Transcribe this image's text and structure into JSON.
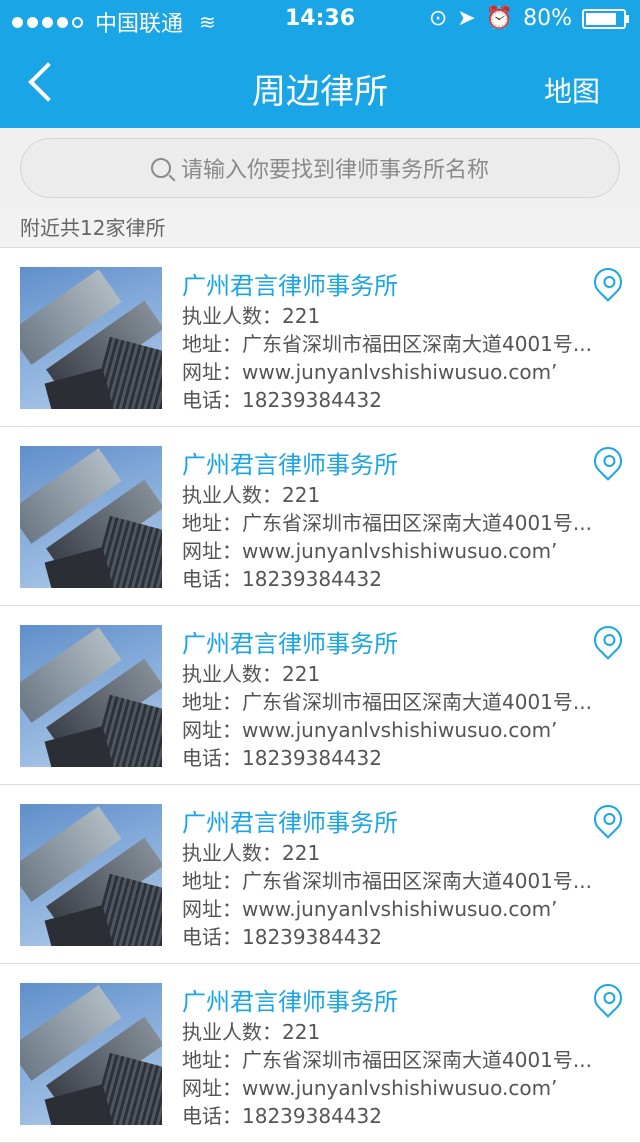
{
  "status": {
    "carrier": "中国联通",
    "time": "14:36",
    "battery": "80%"
  },
  "nav": {
    "title": "周边律所",
    "map_button": "地图"
  },
  "search": {
    "placeholder": "请输入你要找到律师事务所名称"
  },
  "summary": "附近共12家律所",
  "firms": [
    {
      "name": "广州君言律师事务所",
      "staff": "执业人数：221",
      "address": "地址：广东省深圳市福田区深南大道4001号...",
      "website": "网址：www.junyanlvshishiwusuo.com’",
      "phone": "电话：18239384432"
    },
    {
      "name": "广州君言律师事务所",
      "staff": "执业人数：221",
      "address": "地址：广东省深圳市福田区深南大道4001号...",
      "website": "网址：www.junyanlvshishiwusuo.com’",
      "phone": "电话：18239384432"
    },
    {
      "name": "广州君言律师事务所",
      "staff": "执业人数：221",
      "address": "地址：广东省深圳市福田区深南大道4001号...",
      "website": "网址：www.junyanlvshishiwusuo.com’",
      "phone": "电话：18239384432"
    },
    {
      "name": "广州君言律师事务所",
      "staff": "执业人数：221",
      "address": "地址：广东省深圳市福田区深南大道4001号...",
      "website": "网址：www.junyanlvshishiwusuo.com’",
      "phone": "电话：18239384432"
    },
    {
      "name": "广州君言律师事务所",
      "staff": "执业人数：221",
      "address": "地址：广东省深圳市福田区深南大道4001号...",
      "website": "网址：www.junyanlvshishiwusuo.com’",
      "phone": "电话：18239384432"
    }
  ],
  "colors": {
    "accent": "#1aa5e6",
    "background": "#f2f2f2"
  }
}
